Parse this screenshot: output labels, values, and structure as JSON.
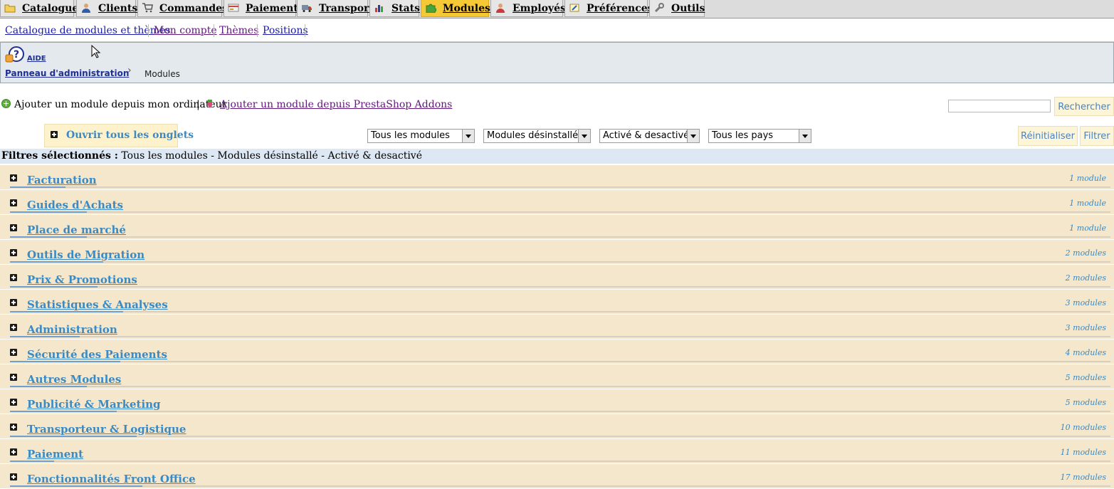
{
  "main_tabs": [
    {
      "label": "Catalogue",
      "icon": "folder-icon",
      "active": false
    },
    {
      "label": "Clients",
      "icon": "user-icon",
      "active": false
    },
    {
      "label": "Commandes",
      "icon": "cart-icon",
      "active": false
    },
    {
      "label": "Paiement",
      "icon": "payment-icon",
      "active": false
    },
    {
      "label": "Transport",
      "icon": "truck-icon",
      "active": false
    },
    {
      "label": "Stats",
      "icon": "chart-icon",
      "active": false
    },
    {
      "label": "Modules",
      "icon": "puzzle-icon",
      "active": true
    },
    {
      "label": "Employés",
      "icon": "employee-icon",
      "active": false
    },
    {
      "label": "Préférences",
      "icon": "preferences-icon",
      "active": false
    },
    {
      "label": "Outils",
      "icon": "wrench-icon",
      "active": false
    }
  ],
  "sub_tabs": [
    {
      "label": "Catalogue de modules et thèmes"
    },
    {
      "label": "Mon compte"
    },
    {
      "label": "Thèmes"
    },
    {
      "label": "Positions"
    }
  ],
  "help": {
    "label": "AIDE"
  },
  "breadcrumb": {
    "home": "Panneau d'administration",
    "current": "Modules"
  },
  "actions": {
    "add_local": "Ajouter un module depuis mon ordinateur",
    "separator": "|",
    "add_addons": "Ajouter un module depuis PrestaShop Addons"
  },
  "search": {
    "value": "",
    "button": "Rechercher"
  },
  "open_all_tabs": "Ouvrir tous les onglets",
  "filters": {
    "modules": "Tous les modules",
    "install": "Modules désinstallé",
    "status": "Activé & desactivé",
    "country": "Tous les pays",
    "reset_button": "Réinitialiser",
    "filter_button": "Filtrer"
  },
  "selected_filters": {
    "label": "Filtres sélectionnés :",
    "value": "Tous les modules - Modules désinstallé - Activé & desactivé"
  },
  "categories": [
    {
      "name": "Facturation",
      "count": "1 module"
    },
    {
      "name": "Guides d'Achats",
      "count": "1 module"
    },
    {
      "name": "Place de marché",
      "count": "1 module"
    },
    {
      "name": "Outils de Migration",
      "count": "2 modules"
    },
    {
      "name": "Prix & Promotions",
      "count": "2 modules"
    },
    {
      "name": "Statistiques & Analyses",
      "count": "3 modules"
    },
    {
      "name": "Administration",
      "count": "3 modules"
    },
    {
      "name": "Sécurité des Paiements",
      "count": "4 modules"
    },
    {
      "name": "Autres Modules",
      "count": "5 modules"
    },
    {
      "name": "Publicité & Marketing",
      "count": "5 modules"
    },
    {
      "name": "Transporteur & Logistique",
      "count": "10 modules"
    },
    {
      "name": "Paiement",
      "count": "11 modules"
    },
    {
      "name": "Fonctionnalités Front Office",
      "count": "17 modules"
    }
  ],
  "colors": {
    "active_tab": "#f5c836",
    "category_bg": "#f4e7cb",
    "link_blue": "#3b8ac4",
    "filters_bg": "#dde8f4"
  }
}
